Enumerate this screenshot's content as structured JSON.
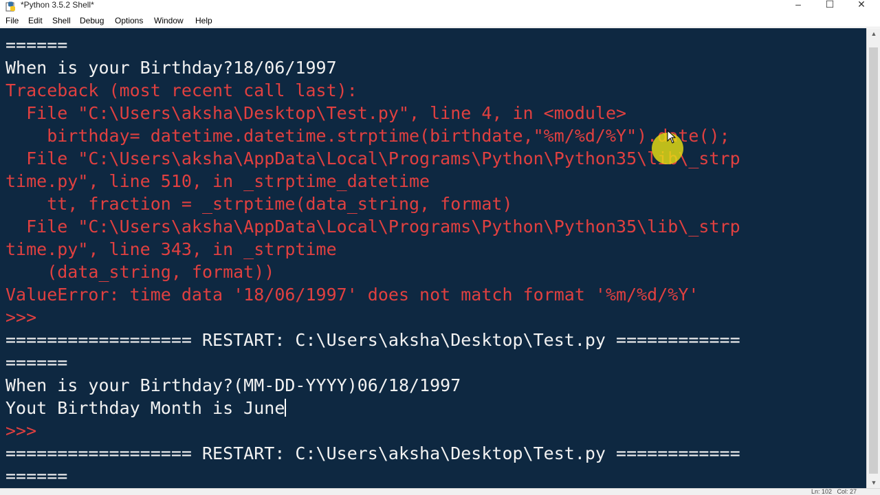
{
  "window": {
    "title": "*Python 3.5.2 Shell*",
    "minimize_label": "–",
    "maximize_label": "☐",
    "close_label": "✕"
  },
  "icons": {
    "app": "python-idle-icon",
    "pointer": "mouse-pointer-icon"
  },
  "menu": [
    "File",
    "Edit",
    "Shell",
    "Debug",
    "Options",
    "Window",
    "Help"
  ],
  "shell": {
    "lines": [
      "======",
      "When is your Birthday?18/06/1997",
      "Traceback (most recent call last):",
      "  File \"C:\\Users\\aksha\\Desktop\\Test.py\", line 4, in <module>",
      "    birthday= datetime.datetime.strptime(birthdate,\"%m/%d/%Y\").date();",
      "  File \"C:\\Users\\aksha\\AppData\\Local\\Programs\\Python\\Python35\\lib\\_strp",
      "time.py\", line 510, in _strptime_datetime",
      "    tt, fraction = _strptime(data_string, format)",
      "  File \"C:\\Users\\aksha\\AppData\\Local\\Programs\\Python\\Python35\\lib\\_strp",
      "time.py\", line 343, in _strptime",
      "    (data_string, format))",
      "ValueError: time data '18/06/1997' does not match format '%m/%d/%Y'",
      ">>> ",
      "================== RESTART: C:\\Users\\aksha\\Desktop\\Test.py ============",
      "======",
      "When is your Birthday?(MM-DD-YYYY)06/18/1997",
      "Yout Birthday Month is June",
      ">>> ",
      "================== RESTART: C:\\Users\\aksha\\Desktop\\Test.py ============",
      "======"
    ]
  },
  "statusbar": {
    "text": "Ln: 102   Col: 27"
  },
  "colors": {
    "background": "#0e2841",
    "stdout": "#f2f2f2",
    "error": "#e04040",
    "input": "#3e8ac6",
    "cursor_highlight": "#e6de14"
  }
}
